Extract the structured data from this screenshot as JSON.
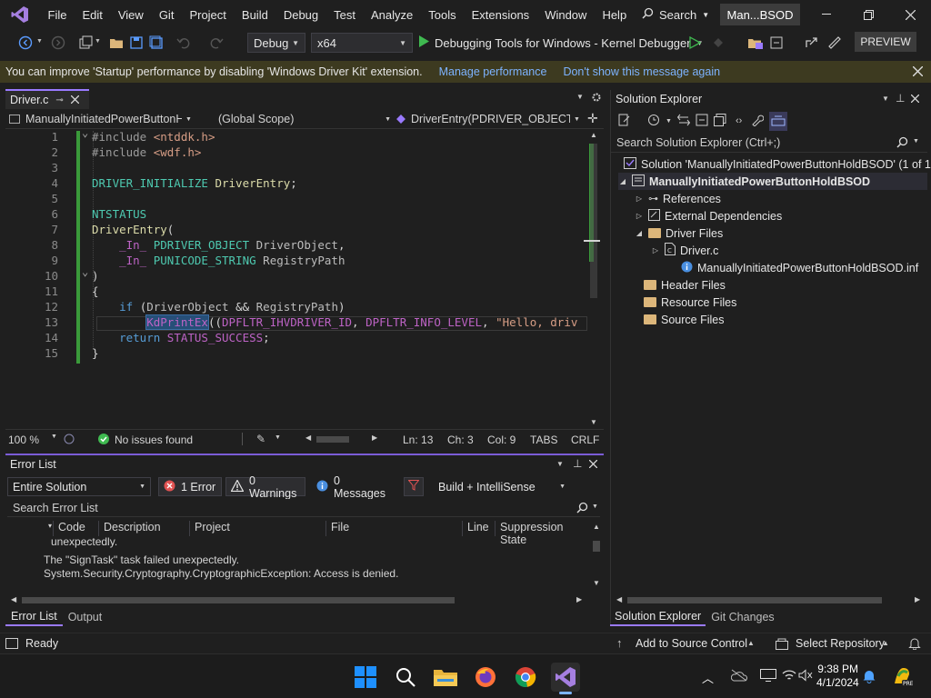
{
  "menu": {
    "items": [
      "File",
      "Edit",
      "View",
      "Git",
      "Project",
      "Build",
      "Debug",
      "Test",
      "Analyze",
      "Tools",
      "Extensions",
      "Window",
      "Help"
    ],
    "search_label": "Search",
    "solution_title": "Man...BSOD"
  },
  "toolbar": {
    "config": "Debug",
    "platform": "x64",
    "debugger": "Debugging Tools for Windows - Kernel Debugger",
    "preview_label": "PREVIEW"
  },
  "infobar": {
    "message": "You can improve 'Startup' performance by disabling 'Windows Driver Kit' extension.",
    "link_manage": "Manage performance",
    "link_dismiss": "Don't show this message again"
  },
  "editor": {
    "tab_label": "Driver.c",
    "nav_project": "ManuallyInitiatedPowerButtonHc",
    "nav_scope": "(Global Scope)",
    "nav_function": "DriverEntry(PDRIVER_OBJECT Driv",
    "lines": [
      {
        "n": "1",
        "segs": [
          {
            "c": "pp",
            "t": "#include "
          },
          {
            "c": "st",
            "t": "<ntddk.h>"
          }
        ]
      },
      {
        "n": "2",
        "segs": [
          {
            "c": "pp",
            "t": "#include "
          },
          {
            "c": "st",
            "t": "<wdf.h>"
          }
        ]
      },
      {
        "n": "3",
        "segs": []
      },
      {
        "n": "4",
        "segs": [
          {
            "c": "ty",
            "t": "DRIVER_INITIALIZE"
          },
          {
            "c": "pl",
            "t": " "
          },
          {
            "c": "fn",
            "t": "DriverEntry"
          },
          {
            "c": "pl",
            "t": ";"
          }
        ]
      },
      {
        "n": "5",
        "segs": []
      },
      {
        "n": "6",
        "segs": [
          {
            "c": "ty",
            "t": "NTSTATUS"
          }
        ]
      },
      {
        "n": "7",
        "segs": [
          {
            "c": "fn",
            "t": "DriverEntry"
          },
          {
            "c": "pl",
            "t": "("
          }
        ]
      },
      {
        "n": "8",
        "segs": [
          {
            "c": "pl",
            "t": "    "
          },
          {
            "c": "mc",
            "t": "_In_"
          },
          {
            "c": "pl",
            "t": " "
          },
          {
            "c": "ty",
            "t": "PDRIVER_OBJECT"
          },
          {
            "c": "pl",
            "t": " "
          },
          {
            "c": "gm",
            "t": "DriverObject"
          },
          {
            "c": "pl",
            "t": ","
          }
        ]
      },
      {
        "n": "9",
        "segs": [
          {
            "c": "pl",
            "t": "    "
          },
          {
            "c": "mc",
            "t": "_In_"
          },
          {
            "c": "pl",
            "t": " "
          },
          {
            "c": "ty",
            "t": "PUNICODE_STRING"
          },
          {
            "c": "pl",
            "t": " "
          },
          {
            "c": "gm",
            "t": "RegistryPath"
          }
        ]
      },
      {
        "n": "10",
        "segs": [
          {
            "c": "pl",
            "t": ")"
          }
        ]
      },
      {
        "n": "11",
        "segs": [
          {
            "c": "pl",
            "t": "{"
          }
        ]
      },
      {
        "n": "12",
        "segs": [
          {
            "c": "pl",
            "t": "    "
          },
          {
            "c": "kw",
            "t": "if"
          },
          {
            "c": "pl",
            "t": " ("
          },
          {
            "c": "gm",
            "t": "DriverObject"
          },
          {
            "c": "pl",
            "t": " && "
          },
          {
            "c": "gm",
            "t": "RegistryPath"
          },
          {
            "c": "pl",
            "t": ")"
          }
        ]
      },
      {
        "n": "13",
        "segs": [
          {
            "c": "pl",
            "t": "        "
          },
          {
            "c": "mc sel",
            "t": "KdPrintEx"
          },
          {
            "c": "pl",
            "t": "(("
          },
          {
            "c": "mc",
            "t": "DPFLTR_IHVDRIVER_ID"
          },
          {
            "c": "pl",
            "t": ", "
          },
          {
            "c": "mc",
            "t": "DPFLTR_INFO_LEVEL"
          },
          {
            "c": "pl",
            "t": ", "
          },
          {
            "c": "st",
            "t": "\"Hello, driv"
          }
        ]
      },
      {
        "n": "14",
        "segs": [
          {
            "c": "pl",
            "t": "    "
          },
          {
            "c": "kw",
            "t": "return"
          },
          {
            "c": "pl",
            "t": " "
          },
          {
            "c": "mc",
            "t": "STATUS_SUCCESS"
          },
          {
            "c": "pl",
            "t": ";"
          }
        ]
      },
      {
        "n": "15",
        "segs": [
          {
            "c": "pl",
            "t": "}"
          }
        ]
      }
    ]
  },
  "editor_status": {
    "zoom": "100 %",
    "issues": "No issues found",
    "ln": "Ln: 13",
    "ch": "Ch: 3",
    "col": "Col: 9",
    "tabs": "TABS",
    "eol": "CRLF"
  },
  "error_list": {
    "title": "Error List",
    "scope": "Entire Solution",
    "errors": "1 Error",
    "warnings": "0 Warnings",
    "messages": "0 Messages",
    "build_filter": "Build + IntelliSense",
    "search_placeholder": "Search Error List",
    "columns": [
      "Code",
      "Description",
      "Project",
      "File",
      "Line",
      "Suppression State"
    ],
    "message_lines": [
      "unexpectedly.",
      "The \"SignTask\" task failed unexpectedly.",
      "System.Security.Cryptography.CryptographicException: Access is denied."
    ]
  },
  "bottom_tabs": [
    "Error List",
    "Output"
  ],
  "solution_explorer": {
    "title": "Solution Explorer",
    "search_placeholder": "Search Solution Explorer (Ctrl+;)",
    "solution_line": "Solution 'ManuallyInitiatedPowerButtonHoldBSOD' (1 of 1",
    "project": "ManuallyInitiatedPowerButtonHoldBSOD",
    "items": [
      "References",
      "External Dependencies",
      "Driver Files",
      "Driver.c",
      "ManuallyInitiatedPowerButtonHoldBSOD.inf",
      "Header Files",
      "Resource Files",
      "Source Files"
    ]
  },
  "side_tabs": [
    "Solution Explorer",
    "Git Changes"
  ],
  "statusbar": {
    "ready": "Ready",
    "source_control": "Add to Source Control",
    "repo": "Select Repository"
  },
  "taskbar": {
    "time": "9:38 PM",
    "date": "4/1/2024"
  },
  "colors": {
    "accent": "#9a7aff",
    "infobar_bg": "#3d3a20",
    "link": "#7db3ff",
    "error_red": "#e05252"
  }
}
